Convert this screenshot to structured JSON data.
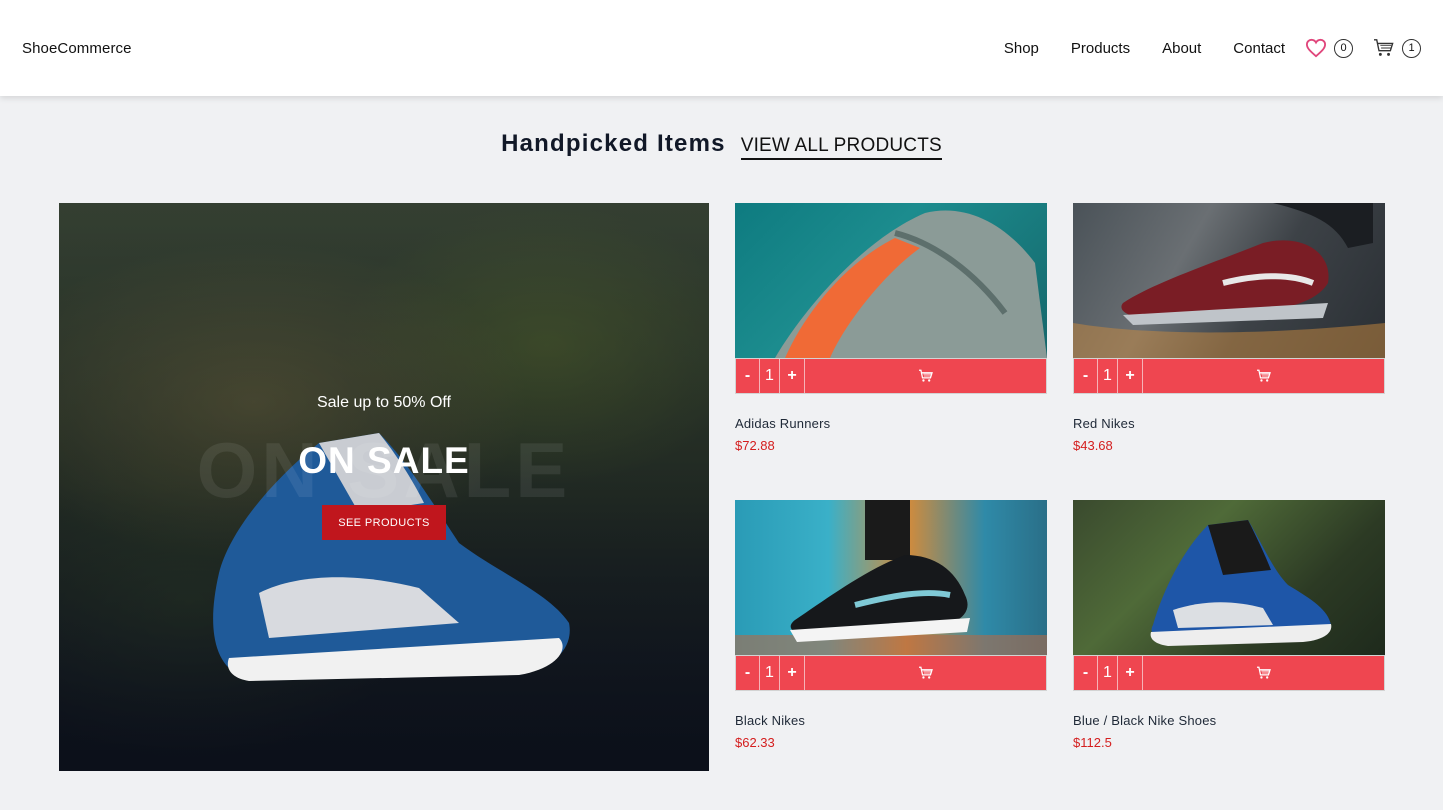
{
  "header": {
    "brand": "ShoeCommerce",
    "nav": [
      "Shop",
      "Products",
      "About",
      "Contact"
    ],
    "wishlist_count": "0",
    "cart_count": "1"
  },
  "section": {
    "title": "Handpicked Items",
    "view_all": "VIEW ALL PRODUCTS"
  },
  "hero": {
    "ghost_text": "ON SALE",
    "subtitle": "Sale up to 50% Off",
    "title": "ON SALE",
    "button": "SEE PRODUCTS"
  },
  "products": [
    {
      "name": "Adidas Runners",
      "price": "$72.88",
      "qty": "1"
    },
    {
      "name": "Red Nikes",
      "price": "$43.68",
      "qty": "1"
    },
    {
      "name": "Black Nikes",
      "price": "$62.33",
      "qty": "1"
    },
    {
      "name": "Blue / Black Nike Shoes",
      "price": "$112.5",
      "qty": "1"
    }
  ],
  "controls": {
    "minus": "-",
    "plus": "+"
  },
  "colors": {
    "accent": "#ef4650",
    "sale_button": "#c0161d",
    "price": "#d41e1e",
    "heart": "#e0457b"
  },
  "icons": {
    "wishlist": "heart-icon",
    "cart": "cart-icon",
    "add_to_cart": "cart-icon"
  }
}
